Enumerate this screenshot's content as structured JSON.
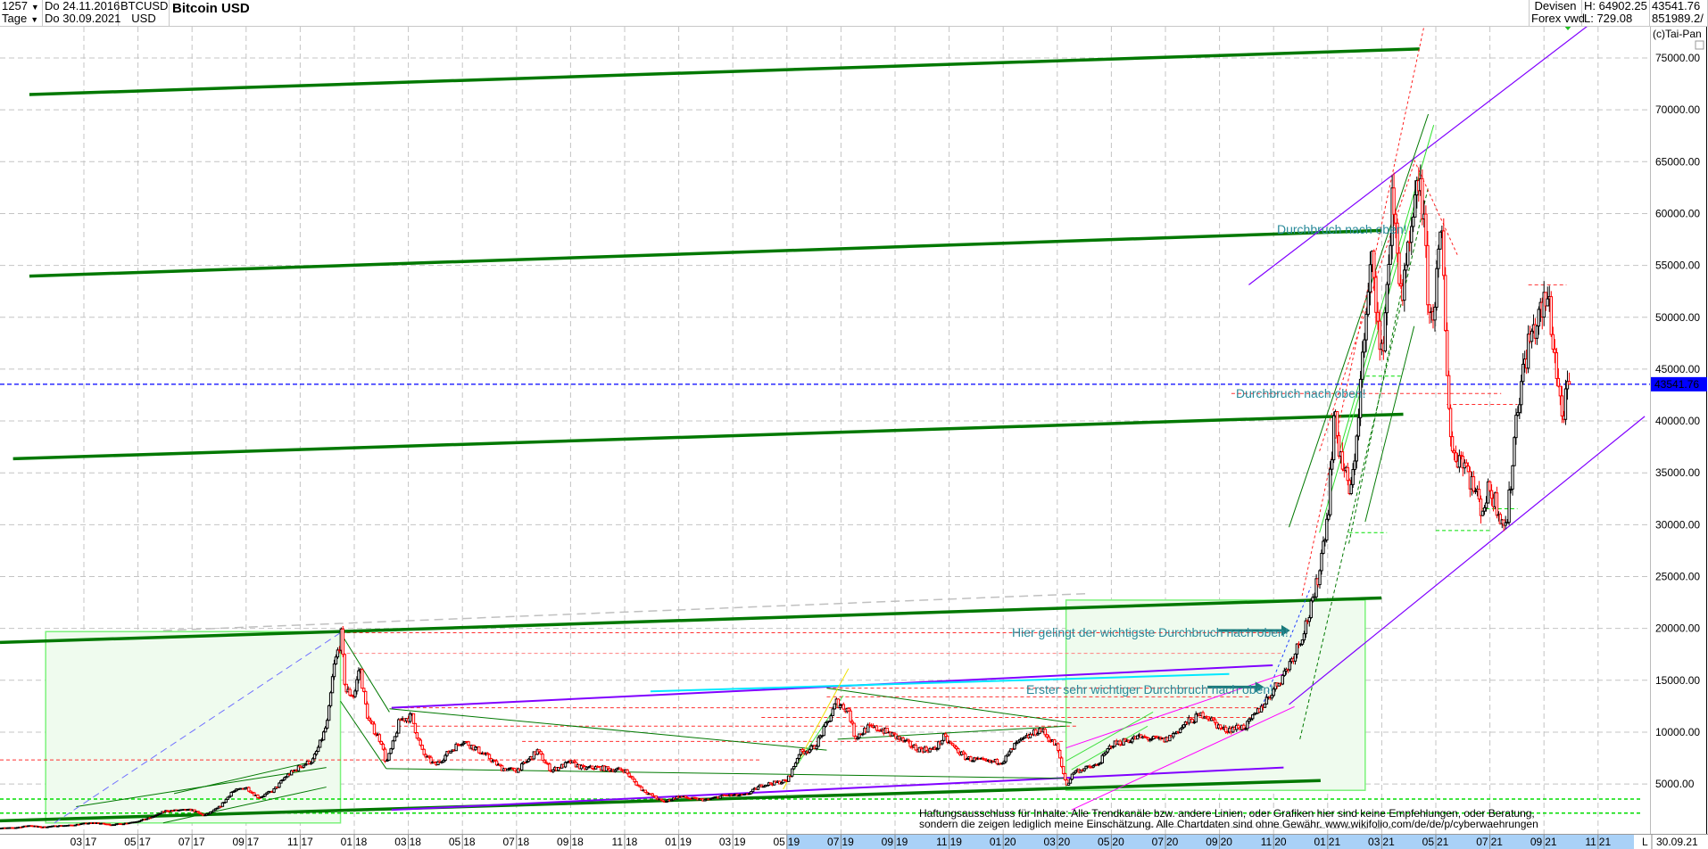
{
  "header": {
    "count": "1257",
    "period": "Tage",
    "date_from": "Do 24.11.2016",
    "date_to": "Do 30.09.2021",
    "symbol": "BTCUSD",
    "currency": "USD",
    "title": "Bitcoin USD",
    "source_line1": "Devisen",
    "source_line2": "Forex vwd",
    "high": "H: 64902.25",
    "low": "L: 729.08",
    "last": "43541.76",
    "volume": "851989.2/",
    "copyright": "(c)Tai-Pan"
  },
  "annotations": {
    "break1": "Durchbruch nach oben!",
    "break2": "Durchbruch nach oben!",
    "most_important": "Hier gelingt der wichtigste Durchbruch nach oben!",
    "first_important": "Erster sehr wichtiger Durchbruch nach oben!"
  },
  "disclaimer": {
    "line1": "Haftungsausschluss für Inhalte: Alle Trendkanäle bzw. andere Linien, oder Grafiken hier sind keine Empfehlungen, oder Beratung,",
    "line2": "sondern die zeigen lediglich meine  Einschätzung. Alle Chartdaten sind ohne Gewähr.  www.wikifolio.com/de/de/p/cyberwaehrungen"
  },
  "footer": {
    "scale_mode": "L",
    "end_date": "30.09.21"
  },
  "colors": {
    "up": "#000000",
    "down": "#ff0000",
    "last_price": "#0000ff",
    "trend": "#007800",
    "channel": "#8000ff",
    "note": "#2a8a9a"
  },
  "chart_data": {
    "type": "candlestick",
    "title": "Bitcoin USD",
    "ylim": [
      0,
      78000
    ],
    "y_ticks": [
      "5000.00",
      "10000.00",
      "15000.00",
      "20000.00",
      "25000.00",
      "30000.00",
      "35000.00",
      "40000.00",
      "45000.00",
      "50000.00",
      "55000.00",
      "60000.00",
      "65000.00",
      "70000.00",
      "75000.00"
    ],
    "last_price": 43541.76,
    "last_price_label": "43541.76",
    "grid": true,
    "x_ticks": [
      {
        "m": "03",
        "y": "17",
        "date": "2017-03-01"
      },
      {
        "m": "05",
        "y": "17",
        "date": "2017-05-01"
      },
      {
        "m": "07",
        "y": "17",
        "date": "2017-07-01"
      },
      {
        "m": "09",
        "y": "17",
        "date": "2017-09-01"
      },
      {
        "m": "11",
        "y": "17",
        "date": "2017-11-01"
      },
      {
        "m": "01",
        "y": "18",
        "date": "2018-01-01"
      },
      {
        "m": "03",
        "y": "18",
        "date": "2018-03-01"
      },
      {
        "m": "05",
        "y": "18",
        "date": "2018-05-01"
      },
      {
        "m": "07",
        "y": "18",
        "date": "2018-07-01"
      },
      {
        "m": "09",
        "y": "18",
        "date": "2018-09-01"
      },
      {
        "m": "11",
        "y": "18",
        "date": "2018-11-01"
      },
      {
        "m": "01",
        "y": "19",
        "date": "2019-01-01"
      },
      {
        "m": "03",
        "y": "19",
        "date": "2019-03-01"
      },
      {
        "m": "05",
        "y": "19",
        "date": "2019-05-01"
      },
      {
        "m": "07",
        "y": "19",
        "date": "2019-07-01"
      },
      {
        "m": "09",
        "y": "19",
        "date": "2019-09-01"
      },
      {
        "m": "11",
        "y": "19",
        "date": "2019-11-01"
      },
      {
        "m": "01",
        "y": "20",
        "date": "2020-01-01"
      },
      {
        "m": "03",
        "y": "20",
        "date": "2020-03-01"
      },
      {
        "m": "05",
        "y": "20",
        "date": "2020-05-01"
      },
      {
        "m": "07",
        "y": "20",
        "date": "2020-07-01"
      },
      {
        "m": "09",
        "y": "20",
        "date": "2020-09-01"
      },
      {
        "m": "11",
        "y": "20",
        "date": "2020-11-01"
      },
      {
        "m": "01",
        "y": "21",
        "date": "2021-01-01"
      },
      {
        "m": "03",
        "y": "21",
        "date": "2021-03-01"
      },
      {
        "m": "05",
        "y": "21",
        "date": "2021-05-01"
      },
      {
        "m": "07",
        "y": "21",
        "date": "2021-07-01"
      },
      {
        "m": "09",
        "y": "21",
        "date": "2021-09-01"
      },
      {
        "m": "11",
        "y": "21",
        "date": "2021-11-01"
      }
    ],
    "series": [
      [
        "2016-11-24",
        740
      ],
      [
        "2016-12-15",
        780
      ],
      [
        "2017-01-01",
        1000
      ],
      [
        "2017-01-15",
        830
      ],
      [
        "2017-02-01",
        970
      ],
      [
        "2017-02-15",
        1010
      ],
      [
        "2017-03-01",
        1190
      ],
      [
        "2017-03-15",
        1250
      ],
      [
        "2017-04-01",
        1080
      ],
      [
        "2017-04-15",
        1180
      ],
      [
        "2017-05-01",
        1420
      ],
      [
        "2017-05-15",
        1750
      ],
      [
        "2017-06-01",
        2400
      ],
      [
        "2017-06-15",
        2450
      ],
      [
        "2017-07-01",
        2500
      ],
      [
        "2017-07-15",
        1950
      ],
      [
        "2017-08-01",
        2750
      ],
      [
        "2017-08-15",
        4200
      ],
      [
        "2017-09-01",
        4700
      ],
      [
        "2017-09-15",
        3700
      ],
      [
        "2017-10-01",
        4350
      ],
      [
        "2017-10-15",
        5700
      ],
      [
        "2017-11-01",
        6700
      ],
      [
        "2017-11-15",
        7300
      ],
      [
        "2017-12-01",
        10900
      ],
      [
        "2017-12-08",
        16000
      ],
      [
        "2017-12-17",
        19300
      ],
      [
        "2017-12-22",
        14000
      ],
      [
        "2018-01-01",
        13500
      ],
      [
        "2018-01-07",
        16500
      ],
      [
        "2018-01-17",
        11200
      ],
      [
        "2018-02-01",
        9100
      ],
      [
        "2018-02-06",
        7000
      ],
      [
        "2018-02-20",
        11200
      ],
      [
        "2018-03-05",
        11500
      ],
      [
        "2018-03-18",
        7900
      ],
      [
        "2018-04-01",
        6800
      ],
      [
        "2018-04-15",
        8000
      ],
      [
        "2018-05-01",
        9200
      ],
      [
        "2018-05-15",
        8500
      ],
      [
        "2018-06-01",
        7500
      ],
      [
        "2018-06-15",
        6500
      ],
      [
        "2018-07-01",
        6300
      ],
      [
        "2018-07-25",
        8200
      ],
      [
        "2018-08-10",
        6300
      ],
      [
        "2018-09-01",
        7100
      ],
      [
        "2018-09-15",
        6500
      ],
      [
        "2018-10-01",
        6600
      ],
      [
        "2018-10-15",
        6400
      ],
      [
        "2018-11-01",
        6350
      ],
      [
        "2018-11-20",
        4500
      ],
      [
        "2018-12-15",
        3250
      ],
      [
        "2019-01-01",
        3800
      ],
      [
        "2019-01-15",
        3600
      ],
      [
        "2019-02-01",
        3450
      ],
      [
        "2019-02-20",
        3900
      ],
      [
        "2019-03-15",
        3900
      ],
      [
        "2019-04-03",
        4900
      ],
      [
        "2019-05-01",
        5300
      ],
      [
        "2019-05-15",
        8000
      ],
      [
        "2019-06-01",
        8500
      ],
      [
        "2019-06-26",
        12900
      ],
      [
        "2019-07-10",
        12100
      ],
      [
        "2019-07-17",
        9500
      ],
      [
        "2019-08-01",
        10400
      ],
      [
        "2019-08-15",
        10300
      ],
      [
        "2019-09-01",
        9600
      ],
      [
        "2019-09-25",
        8400
      ],
      [
        "2019-10-15",
        8300
      ],
      [
        "2019-10-26",
        9500
      ],
      [
        "2019-11-20",
        7500
      ],
      [
        "2019-12-15",
        7100
      ],
      [
        "2020-01-01",
        7200
      ],
      [
        "2020-01-15",
        8800
      ],
      [
        "2020-02-12",
        10300
      ],
      [
        "2020-03-01",
        8600
      ],
      [
        "2020-03-12",
        4900
      ],
      [
        "2020-03-20",
        6200
      ],
      [
        "2020-04-15",
        6800
      ],
      [
        "2020-05-01",
        8800
      ],
      [
        "2020-06-01",
        9500
      ],
      [
        "2020-07-01",
        9200
      ],
      [
        "2020-07-27",
        11000
      ],
      [
        "2020-08-15",
        11800
      ],
      [
        "2020-09-05",
        10200
      ],
      [
        "2020-10-01",
        10600
      ],
      [
        "2020-10-21",
        12800
      ],
      [
        "2020-11-15",
        16000
      ],
      [
        "2020-12-01",
        19000
      ],
      [
        "2020-12-17",
        23000
      ],
      [
        "2021-01-02",
        32000
      ],
      [
        "2021-01-08",
        40500
      ],
      [
        "2021-01-20",
        35000
      ],
      [
        "2021-01-28",
        33000
      ],
      [
        "2021-02-09",
        46000
      ],
      [
        "2021-02-20",
        57000
      ],
      [
        "2021-02-28",
        45000
      ],
      [
        "2021-03-13",
        61000
      ],
      [
        "2021-03-25",
        52000
      ],
      [
        "2021-04-14",
        64000
      ],
      [
        "2021-04-25",
        49000
      ],
      [
        "2021-05-08",
        58000
      ],
      [
        "2021-05-19",
        37000
      ],
      [
        "2021-06-01",
        36500
      ],
      [
        "2021-06-22",
        31500
      ],
      [
        "2021-07-01",
        33500
      ],
      [
        "2021-07-20",
        29800
      ],
      [
        "2021-08-01",
        41500
      ],
      [
        "2021-08-14",
        47500
      ],
      [
        "2021-09-06",
        52000
      ],
      [
        "2021-09-21",
        40500
      ],
      [
        "2021-09-30",
        43541.76
      ]
    ]
  }
}
